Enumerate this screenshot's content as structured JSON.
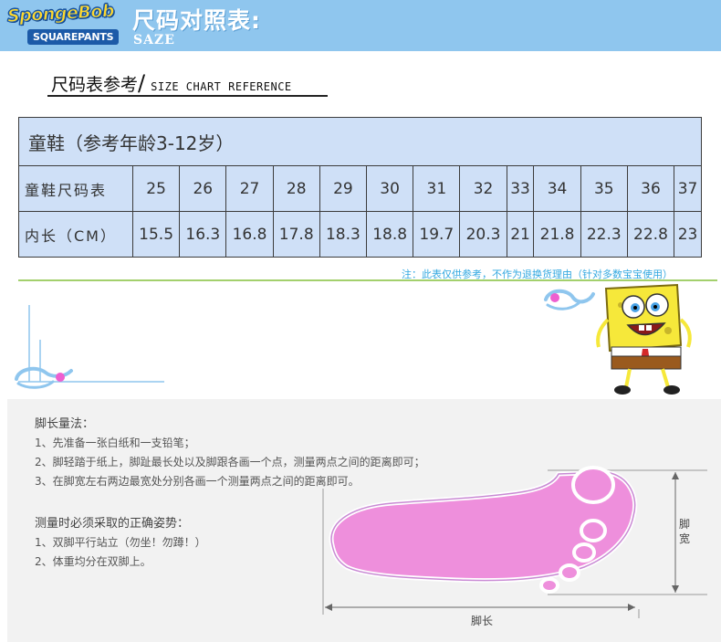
{
  "header": {
    "logo_top": "SpongeBob",
    "logo_bottom": "SQUAREPANTS",
    "title": "尺码对照表:",
    "subtitle": "SAZE"
  },
  "reference": {
    "title": "尺码表参考",
    "slash": "/",
    "subtitle": "SIZE CHART REFERENCE"
  },
  "table": {
    "heading": "童鞋（参考年龄3-12岁）",
    "size_label": "童鞋尺码表",
    "length_label": "内长（CM）",
    "sizes": [
      "25",
      "26",
      "27",
      "28",
      "29",
      "30",
      "31",
      "32",
      "33",
      "34",
      "35",
      "36",
      "37"
    ],
    "lengths": [
      "15.5",
      "16.3",
      "16.8",
      "17.8",
      "18.3",
      "18.8",
      "19.7",
      "20.3",
      "21",
      "21.8",
      "22.3",
      "22.8",
      "23"
    ]
  },
  "note": "注：此表仅供参考，不作为退换货理由（针对多数宝宝使用）",
  "measure": {
    "heading": "脚长量法：",
    "steps": [
      "1、先准备一张白纸和一支铅笔；",
      "2、脚轻踏于纸上，脚趾最长处以及脚跟各画一个点，测量两点之间的距离即可；",
      "3、在脚宽左右两边最宽处分别各画一个测量两点之间的距离即可。"
    ]
  },
  "posture": {
    "heading": "测量时必须采取的正确姿势：",
    "steps": [
      "1、双脚平行站立（勿坐！勿蹲！）",
      "2、体重均分在双脚上。"
    ]
  },
  "diagram": {
    "width_label": "脚宽",
    "length_label": "脚长"
  },
  "colors": {
    "banner": "#8fc6ee",
    "table_bg": "#cfe0f7",
    "note": "#33a8e0",
    "foot": "#ee8fdc",
    "green_line": "#a3d06d"
  }
}
